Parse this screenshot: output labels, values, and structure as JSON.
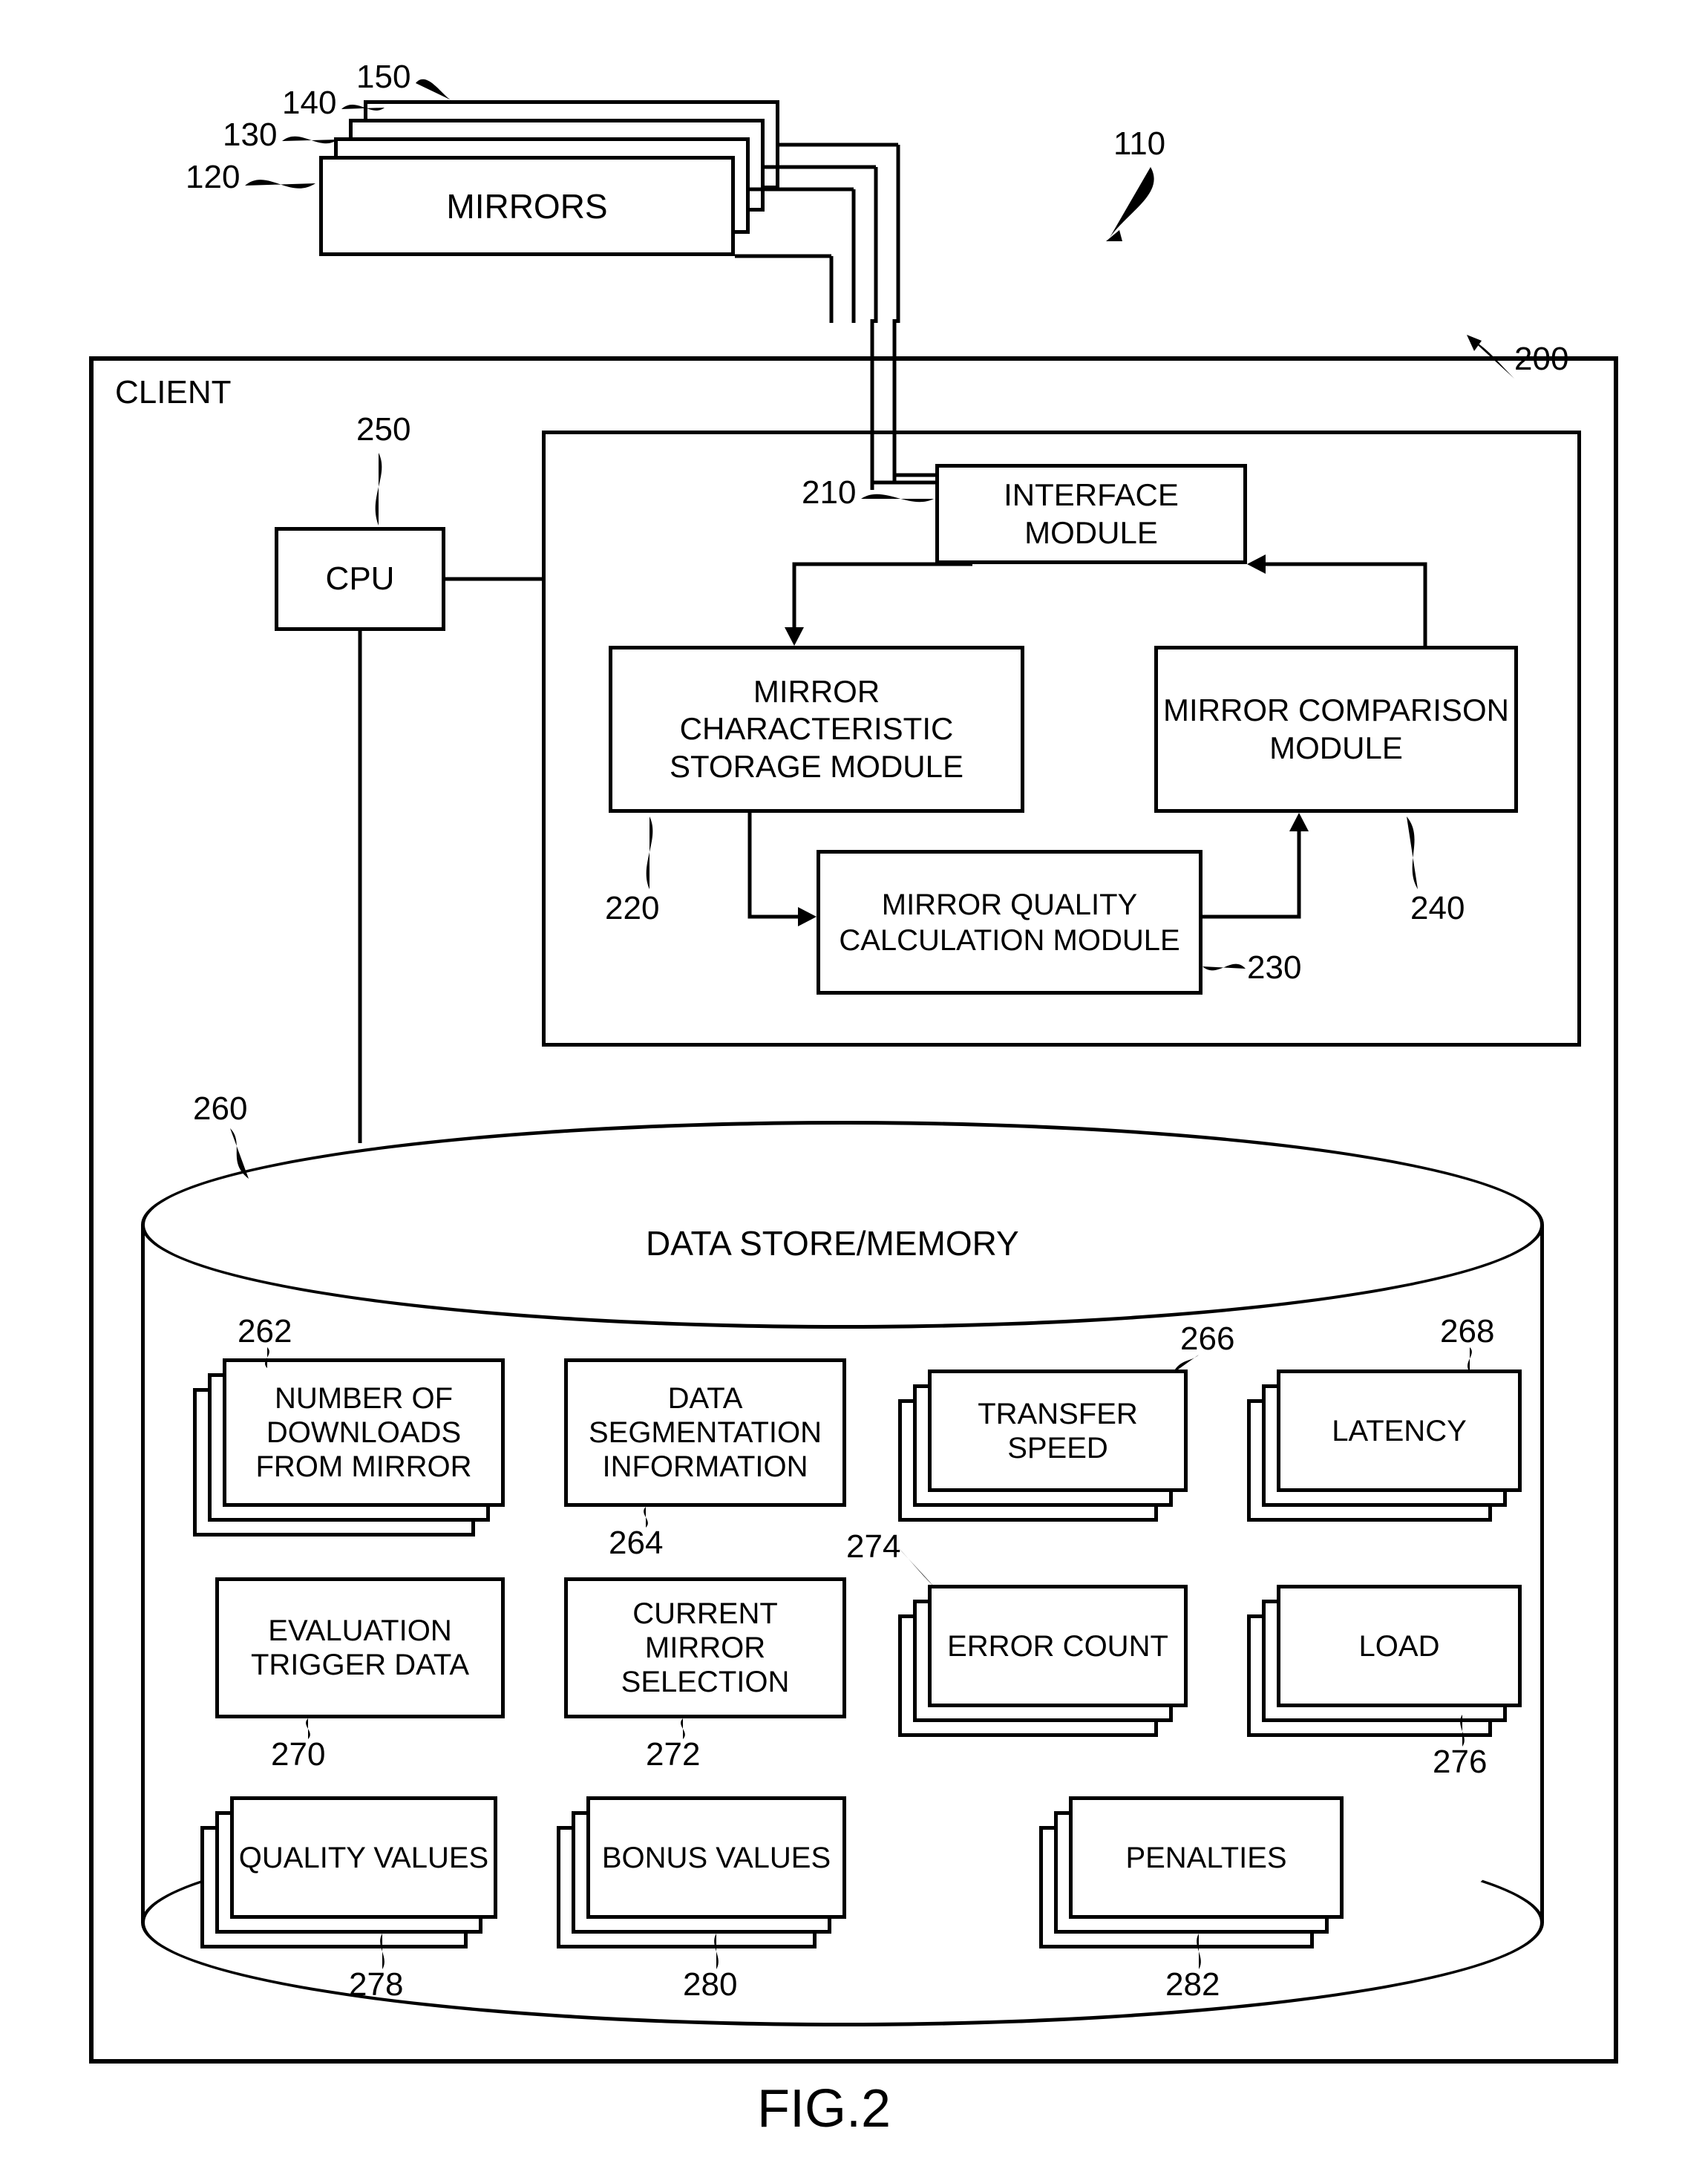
{
  "figure_label": "FIG.2",
  "refs": {
    "r110": "110",
    "r120": "120",
    "r130": "130",
    "r140": "140",
    "r150": "150",
    "r200": "200",
    "r210": "210",
    "r220": "220",
    "r230": "230",
    "r240": "240",
    "r250": "250",
    "r260": "260",
    "r262": "262",
    "r264": "264",
    "r266": "266",
    "r268": "268",
    "r270": "270",
    "r272": "272",
    "r274": "274",
    "r276": "276",
    "r278": "278",
    "r280": "280",
    "r282": "282"
  },
  "blocks": {
    "mirrors": "MIRRORS",
    "client": "CLIENT",
    "cpu": "CPU",
    "interface_module": "INTERFACE MODULE",
    "mirror_char_storage": "MIRROR CHARACTERISTIC STORAGE MODULE",
    "mirror_comparison": "MIRROR COMPARISON MODULE",
    "mirror_quality": "MIRROR QUALITY CALCULATION MODULE",
    "data_store": "DATA STORE/MEMORY",
    "num_downloads": "NUMBER OF DOWNLOADS FROM MIRROR",
    "data_seg": "DATA SEGMENTATION INFORMATION",
    "transfer_speed": "TRANSFER SPEED",
    "latency": "LATENCY",
    "eval_trigger": "EVALUATION TRIGGER DATA",
    "current_mirror": "CURRENT MIRROR SELECTION",
    "error_count": "ERROR COUNT",
    "load": "LOAD",
    "quality_values": "QUALITY VALUES",
    "bonus_values": "BONUS VALUES",
    "penalties": "PENALTIES"
  },
  "chart_data": {
    "type": "diagram",
    "title": "FIG.2",
    "nodes": [
      {
        "id": 110,
        "label": "(overall system pointer)"
      },
      {
        "id": 120,
        "label": "MIRRORS"
      },
      {
        "id": 130,
        "label": "MIRRORS (stack layer)"
      },
      {
        "id": 140,
        "label": "MIRRORS (stack layer)"
      },
      {
        "id": 150,
        "label": "MIRRORS (stack layer)"
      },
      {
        "id": 200,
        "label": "CLIENT"
      },
      {
        "id": 210,
        "label": "INTERFACE MODULE"
      },
      {
        "id": 220,
        "label": "MIRROR CHARACTERISTIC STORAGE MODULE"
      },
      {
        "id": 230,
        "label": "MIRROR QUALITY CALCULATION MODULE"
      },
      {
        "id": 240,
        "label": "MIRROR COMPARISON MODULE"
      },
      {
        "id": 250,
        "label": "CPU"
      },
      {
        "id": 260,
        "label": "DATA STORE/MEMORY"
      },
      {
        "id": 262,
        "label": "NUMBER OF DOWNLOADS FROM MIRROR"
      },
      {
        "id": 264,
        "label": "DATA SEGMENTATION INFORMATION"
      },
      {
        "id": 266,
        "label": "TRANSFER SPEED"
      },
      {
        "id": 268,
        "label": "LATENCY"
      },
      {
        "id": 270,
        "label": "EVALUATION TRIGGER DATA"
      },
      {
        "id": 272,
        "label": "CURRENT MIRROR SELECTION"
      },
      {
        "id": 274,
        "label": "ERROR COUNT"
      },
      {
        "id": 276,
        "label": "LOAD"
      },
      {
        "id": 278,
        "label": "QUALITY VALUES"
      },
      {
        "id": 280,
        "label": "BONUS VALUES"
      },
      {
        "id": 282,
        "label": "PENALTIES"
      }
    ],
    "edges": [
      {
        "from": 120,
        "to": 210,
        "bidirectional": false,
        "note": "mirrors connect into interface module"
      },
      {
        "from": 250,
        "to": 210,
        "bidirectional": false,
        "note": "CPU to module box / interface"
      },
      {
        "from": 250,
        "to": 260,
        "bidirectional": false,
        "note": "CPU to data store"
      },
      {
        "from": 210,
        "to": 220,
        "bidirectional": false
      },
      {
        "from": 220,
        "to": 230,
        "bidirectional": false
      },
      {
        "from": 230,
        "to": 240,
        "bidirectional": false
      },
      {
        "from": 240,
        "to": 210,
        "bidirectional": false
      }
    ],
    "containers": [
      {
        "id": 200,
        "contains": [
          250,
          210,
          220,
          230,
          240,
          260,
          262,
          264,
          266,
          268,
          270,
          272,
          274,
          276,
          278,
          280,
          282
        ]
      },
      {
        "id": 260,
        "contains": [
          262,
          264,
          266,
          268,
          270,
          272,
          274,
          276,
          278,
          280,
          282
        ]
      }
    ]
  }
}
